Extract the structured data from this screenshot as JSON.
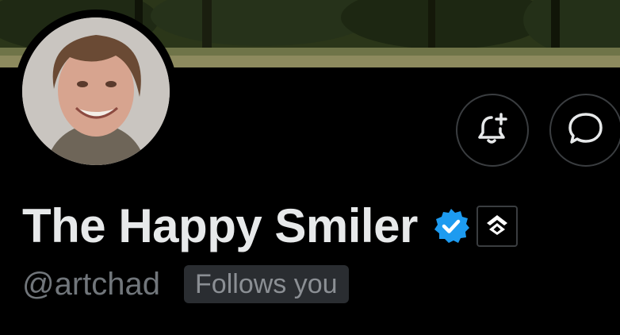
{
  "profile": {
    "display_name": "The Happy Smiler",
    "handle": "@artchad",
    "follows_you": "Follows you",
    "verified": true
  },
  "icons": {
    "notify": "bell-plus-icon",
    "message": "chat-bubble-icon",
    "verified": "verified-badge-icon",
    "affiliate": "affiliate-logo-icon"
  },
  "colors": {
    "background": "#000000",
    "name": "#e7e9ea",
    "handle": "#71767b",
    "verified": "#1d9bf0",
    "button_border": "#3a3d40",
    "badge_bg": "#2a2d31"
  }
}
